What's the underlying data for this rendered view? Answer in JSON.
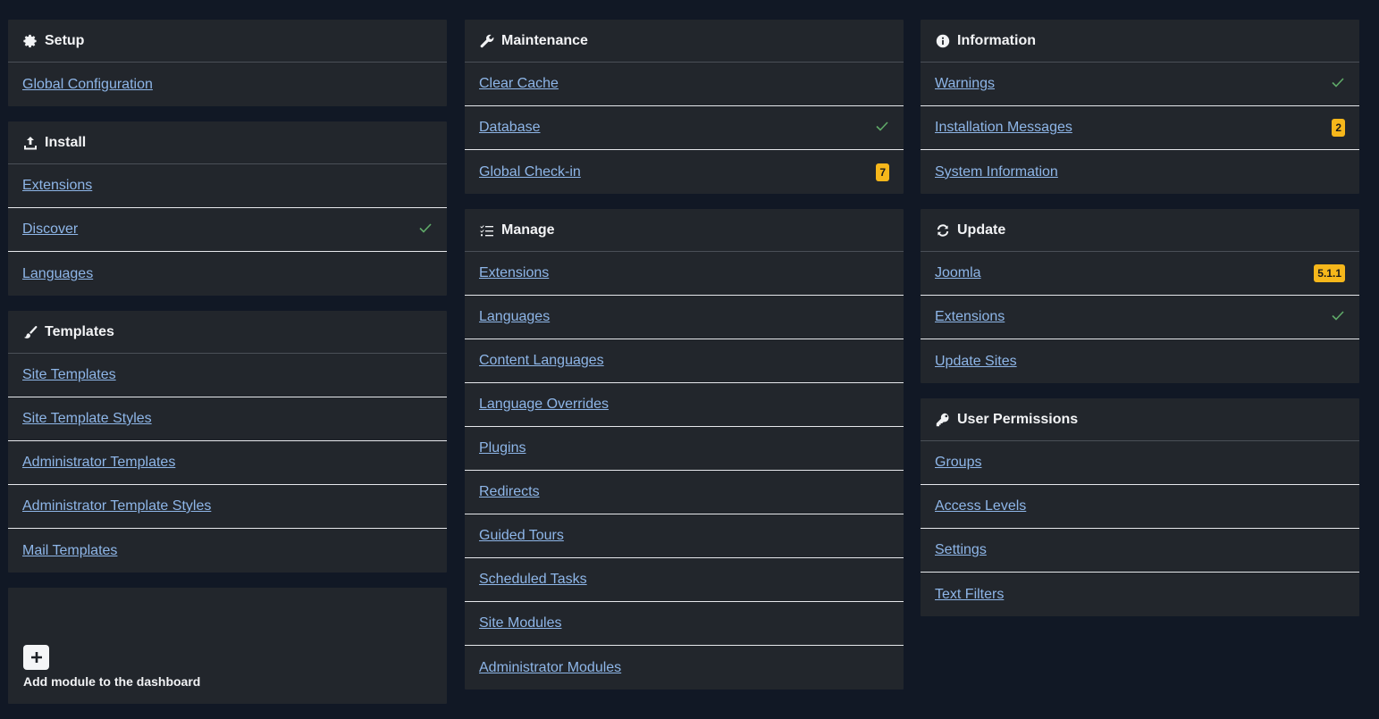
{
  "setup": {
    "title": "Setup",
    "links": [
      "Global Configuration"
    ]
  },
  "install": {
    "title": "Install",
    "links": [
      "Extensions",
      "Discover",
      "Languages"
    ]
  },
  "templates": {
    "title": "Templates",
    "links": [
      "Site Templates",
      "Site Template Styles",
      "Administrator Templates",
      "Administrator Template Styles",
      "Mail Templates"
    ]
  },
  "add_module": {
    "label": "Add module to the dashboard"
  },
  "maintenance": {
    "title": "Maintenance",
    "links": [
      "Clear Cache",
      "Database",
      "Global Check-in"
    ],
    "checkin_badge": "7"
  },
  "manage": {
    "title": "Manage",
    "links": [
      "Extensions",
      "Languages",
      "Content Languages",
      "Language Overrides",
      "Plugins",
      "Redirects",
      "Guided Tours",
      "Scheduled Tasks",
      "Site Modules",
      "Administrator Modules"
    ]
  },
  "information": {
    "title": "Information",
    "links": [
      "Warnings",
      "Installation Messages",
      "System Information"
    ],
    "install_messages_badge": "2"
  },
  "update": {
    "title": "Update",
    "links": [
      "Joomla",
      "Extensions",
      "Update Sites"
    ],
    "joomla_version_badge": "5.1.1"
  },
  "permissions": {
    "title": "User Permissions",
    "links": [
      "Groups",
      "Access Levels",
      "Settings",
      "Text Filters"
    ]
  },
  "colors": {
    "background": "#111825",
    "card": "#22262c",
    "link": "#8eb6e8",
    "badge": "#f6b71b",
    "check": "#5fa968"
  },
  "icons": {
    "setup": "gear-icon",
    "install": "upload-icon",
    "templates": "paintbrush-icon",
    "maintenance": "wrench-icon",
    "manage": "checklist-icon",
    "information": "info-icon",
    "update": "refresh-icon",
    "permissions": "key-icon",
    "status_ok": "checkmark-icon",
    "add": "plus-icon"
  }
}
